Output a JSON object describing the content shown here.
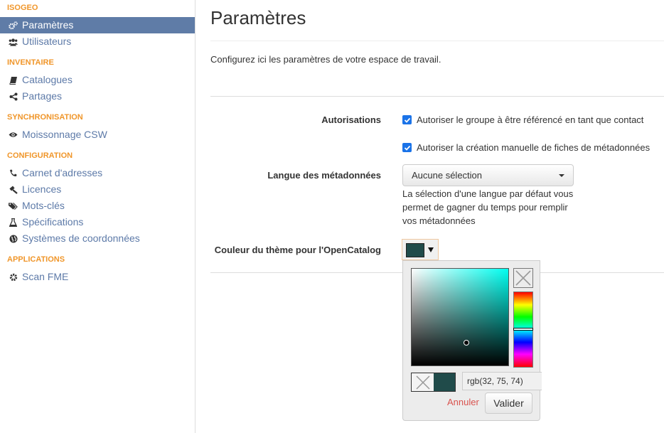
{
  "sidebar": {
    "sections": [
      {
        "title": "ISOGEO",
        "items": [
          {
            "label": "Paramètres",
            "icon": "cogs-icon",
            "active": true
          },
          {
            "label": "Utilisateurs",
            "icon": "users-icon",
            "active": false
          }
        ]
      },
      {
        "title": "INVENTAIRE",
        "items": [
          {
            "label": "Catalogues",
            "icon": "book-icon",
            "active": false
          },
          {
            "label": "Partages",
            "icon": "share-icon",
            "active": false
          }
        ]
      },
      {
        "title": "SYNCHRONISATION",
        "items": [
          {
            "label": "Moissonnage CSW",
            "icon": "eye-icon",
            "active": false
          }
        ]
      },
      {
        "title": "CONFIGURATION",
        "items": [
          {
            "label": "Carnet d'adresses",
            "icon": "phone-icon",
            "active": false
          },
          {
            "label": "Licences",
            "icon": "gavel-icon",
            "active": false
          },
          {
            "label": "Mots-clés",
            "icon": "tags-icon",
            "active": false
          },
          {
            "label": "Spécifications",
            "icon": "flask-icon",
            "active": false
          },
          {
            "label": "Systèmes de coordonnées",
            "icon": "globe-icon",
            "active": false
          }
        ]
      },
      {
        "title": "APPLICATIONS",
        "items": [
          {
            "label": "Scan FME",
            "icon": "cog-icon",
            "active": false
          }
        ]
      }
    ]
  },
  "main": {
    "title": "Paramètres",
    "intro": "Configurez ici les paramètres de votre espace de travail.",
    "authorizations": {
      "label": "Autorisations",
      "options": [
        {
          "label": "Autoriser le groupe à être référencé en tant que contact",
          "checked": true
        },
        {
          "label": "Autoriser la création manuelle de fiches de métadonnées",
          "checked": true
        }
      ]
    },
    "language": {
      "label": "Langue des métadonnées",
      "selected": "Aucune sélection",
      "help": "La sélection d'une langue par défaut vous permet de gagner du temps pour remplir vos métadonnées"
    },
    "theme_color": {
      "label": "Couleur du thème pour l'OpenCatalog",
      "value_hex": "#204b4a",
      "value_text": "rgb(32, 75, 74)",
      "hue_hex": "#00fff0",
      "cancel_label": "Annuler",
      "ok_label": "Valider"
    }
  },
  "colors": {
    "accent_section": "#f0962a",
    "sidebar_active_bg": "#5f7ca7",
    "link": "#5d7aa8",
    "checkbox": "#1a73e8",
    "cancel": "#d9534f"
  }
}
